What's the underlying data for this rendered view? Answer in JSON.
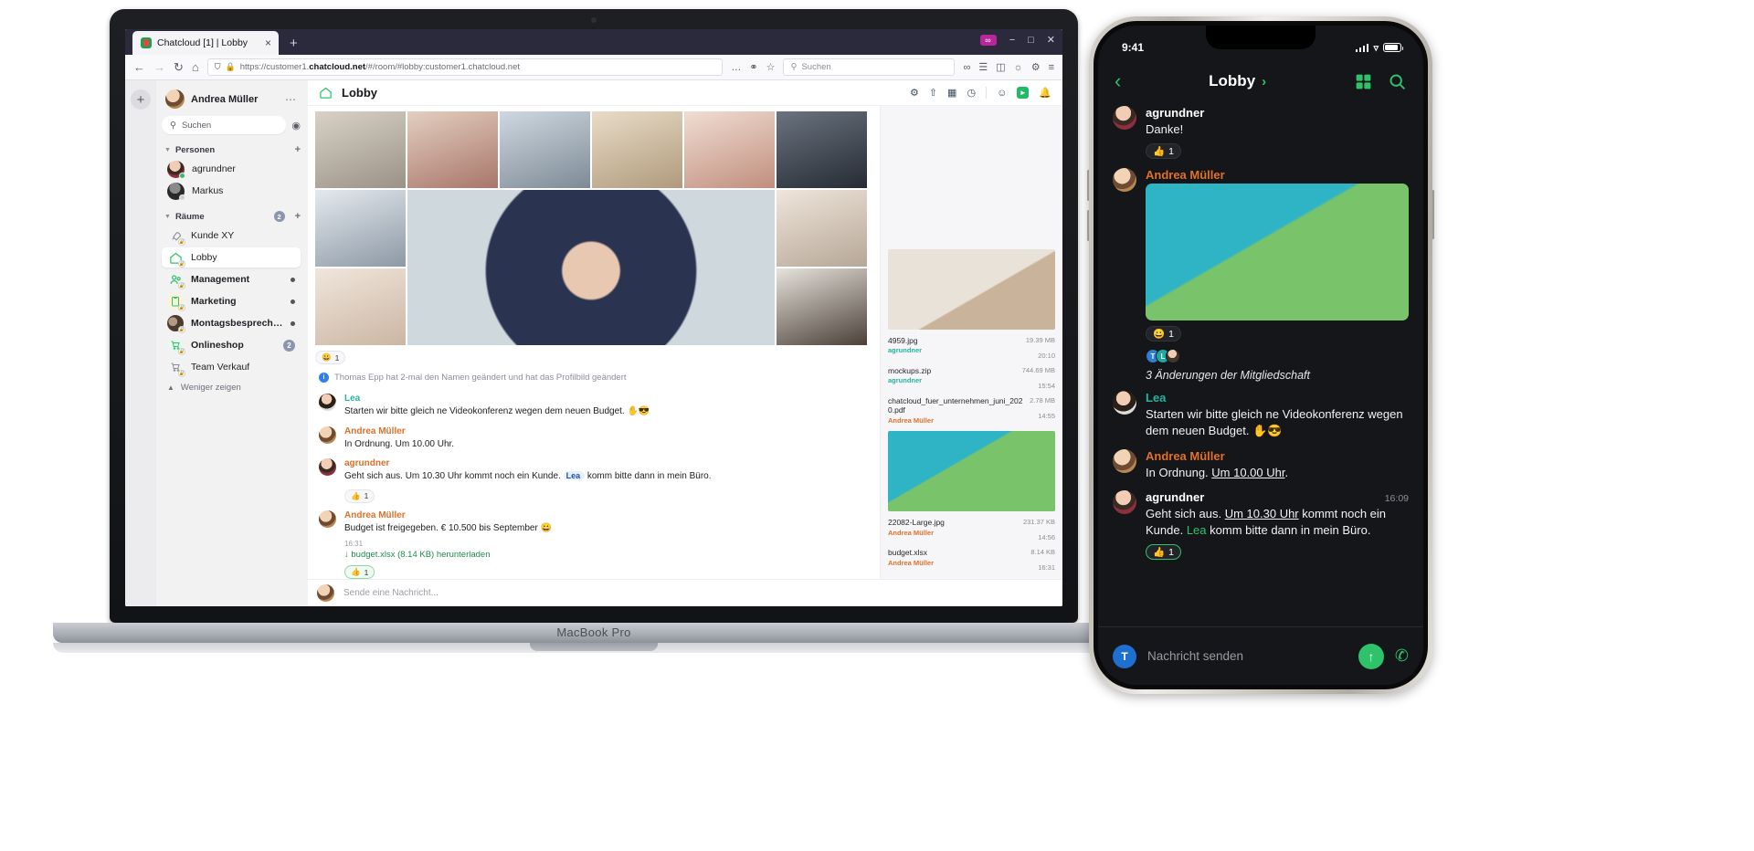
{
  "browser": {
    "tab_title": "Chatcloud [1] | Lobby",
    "tab_close": "×",
    "new_tab": "+",
    "url_prefix": "https://customer1.",
    "url_domain": "chatcloud.net",
    "url_suffix": "/#/room/#lobby:customer1.chatcloud.net",
    "search_placeholder": "Suchen",
    "pocket_label": "∞",
    "win_minimize": "−",
    "win_maximize": "□",
    "win_close": "✕",
    "nav_back": "←",
    "nav_forward": "→",
    "nav_reload": "↻",
    "nav_home": "⌂",
    "shield_icon": "⛉",
    "lock_icon": "🔒",
    "more_icon": "…",
    "menu_icon": "≡"
  },
  "sidebar": {
    "add_label": "+",
    "user": {
      "name": "Andrea Müller",
      "menu": "⋯"
    },
    "search_placeholder": "Suchen",
    "sections": [
      {
        "label": "Personen",
        "count": null,
        "plus": "+"
      },
      {
        "label": "Räume",
        "count": "2",
        "plus": "+"
      }
    ],
    "people": [
      {
        "label": "agrundner",
        "presence": "#2ec36b"
      },
      {
        "label": "Markus",
        "presence": "#cfcfd6"
      }
    ],
    "rooms": [
      {
        "label": "Kunde XY",
        "icon": "rocket-icon",
        "bold": false,
        "badge": null,
        "dot": false,
        "active": false
      },
      {
        "label": "Lobby",
        "icon": "home-icon",
        "bold": false,
        "badge": null,
        "dot": false,
        "active": true
      },
      {
        "label": "Management",
        "icon": "people-icon",
        "bold": true,
        "badge": null,
        "dot": true,
        "active": false
      },
      {
        "label": "Marketing",
        "icon": "clipboard-icon",
        "bold": true,
        "badge": null,
        "dot": true,
        "active": false
      },
      {
        "label": "Montagsbesprechung",
        "icon": "photo-icon",
        "bold": true,
        "badge": null,
        "dot": true,
        "active": false
      },
      {
        "label": "Onlineshop",
        "icon": "cart-icon",
        "bold": true,
        "badge": "2",
        "dot": false,
        "active": false
      },
      {
        "label": "Team Verkauf",
        "icon": "cart2-icon",
        "bold": false,
        "badge": null,
        "dot": false,
        "active": false
      }
    ],
    "show_less": "Weniger zeigen"
  },
  "room": {
    "name": "Lobby",
    "tools": [
      "gear-icon",
      "upload-icon",
      "grid-icon",
      "clock-icon",
      "person-icon",
      "video-icon",
      "bell-icon"
    ],
    "video_reaction": {
      "emoji": "😀",
      "count": "1"
    },
    "system_message": "Thomas Epp hat 2-mal den Namen geändert und hat das Profilbild geändert",
    "messages": [
      {
        "author": "Lea",
        "author_color": "#24b3a0",
        "text": "Starten wir bitte gleich ne Videokonferenz wegen dem neuen Budget.",
        "emojis": "✋😎",
        "reaction": null,
        "timestamp": null
      },
      {
        "author": "Andrea Müller",
        "author_color": "#e0702a",
        "text": "In Ordnung. Um 10.00 Uhr.",
        "emojis": "",
        "reaction": null,
        "timestamp": null
      },
      {
        "author": "agrundner",
        "author_color": "#e0702a",
        "text_pre": "Geht sich aus. Um 10.30 Uhr kommt noch ein Kunde.",
        "mention": "Lea",
        "text_post": "komm bitte dann in mein Büro.",
        "emojis": "",
        "reaction": {
          "emoji": "👍",
          "count": "1"
        },
        "timestamp": null
      },
      {
        "author": "Andrea Müller",
        "author_color": "#e0702a",
        "text": "Budget ist freigegeben. € 10.500 bis September",
        "emojis": "😀",
        "timestamp": "16:31",
        "download": "↓ budget.xlsx (8.14 KB) herunterladen",
        "reaction": {
          "emoji": "👍",
          "count": "1"
        }
      }
    ],
    "composer_placeholder": "Sende eine Nachricht..."
  },
  "files": [
    {
      "name": "4959.jpg",
      "author": "agrundner",
      "author_color": "#24b3a0",
      "size": "19.39 MB",
      "time": "20:10",
      "has_thumb": true
    },
    {
      "name": "mockups.zip",
      "author": "agrundner",
      "author_color": "#24b3a0",
      "size": "744.69 MB",
      "time": "15:54",
      "has_thumb": false
    },
    {
      "name": "chatcloud_fuer_unternehmen_juni_2020.pdf",
      "author": "Andrea Müller",
      "author_color": "#e0702a",
      "size": "2.78 MB",
      "time": "14:55",
      "has_thumb": false
    },
    {
      "name": "22082-Large.jpg",
      "author": "Andrea Müller",
      "author_color": "#e0702a",
      "size": "231.37 KB",
      "time": "14:56",
      "has_thumb": true
    },
    {
      "name": "budget.xlsx",
      "author": "Andrea Müller",
      "author_color": "#e0702a",
      "size": "8.14 KB",
      "time": "16:31",
      "has_thumb": false
    }
  ],
  "laptop": {
    "model": "MacBook Pro"
  },
  "phone": {
    "status_time": "9:41",
    "title": "Lobby",
    "title_chevron": "›",
    "back_icon": "‹",
    "grid_icon": "grid-icon",
    "search_icon": "search-icon",
    "messages": [
      {
        "author": "agrundner",
        "author_color": "#ffffff",
        "text": "Danke!",
        "reaction": {
          "emoji": "👍",
          "count": "1"
        },
        "type": "text",
        "timestamp": null
      },
      {
        "author": "Andrea Müller",
        "author_color": "#e0702a",
        "type": "image",
        "reaction": {
          "emoji": "😀",
          "count": "1"
        },
        "timestamp": null
      },
      {
        "type": "membership",
        "text": "3 Änderungen der Mitgliedschaft",
        "avatars": [
          "T",
          "L",
          "A"
        ]
      },
      {
        "author": "Lea",
        "author_color": "#24b3a0",
        "text": "Starten wir bitte gleich ne Videokonferenz wegen dem neuen Budget. ✋😎",
        "type": "text",
        "timestamp": null
      },
      {
        "author": "Andrea Müller",
        "author_color": "#e0702a",
        "text_pre": "In Ordnung. ",
        "text_underline": "Um 10.00 Uhr",
        "text_post": ".",
        "type": "text-underline",
        "timestamp": null
      },
      {
        "author": "agrundner",
        "author_color": "#ffffff",
        "text_pre": "Geht sich aus. ",
        "text_underline": "Um 10.30 Uhr",
        "text_mid": " kommt noch ein Kunde. ",
        "mention": "Lea",
        "text_post": " komm bitte dann in mein Büro.",
        "type": "text-rich",
        "reaction": {
          "emoji": "👍",
          "count": "1"
        },
        "timestamp": "16:09"
      }
    ],
    "composer_avatar": "T",
    "composer_placeholder": "Nachricht senden",
    "send_icon": "↑",
    "call_icon": "✆"
  },
  "colors": {
    "accent_green": "#2ec36b",
    "brand_teal": "#24b3a0",
    "orange": "#e0702a",
    "badge_blue": "#8b95ad"
  }
}
